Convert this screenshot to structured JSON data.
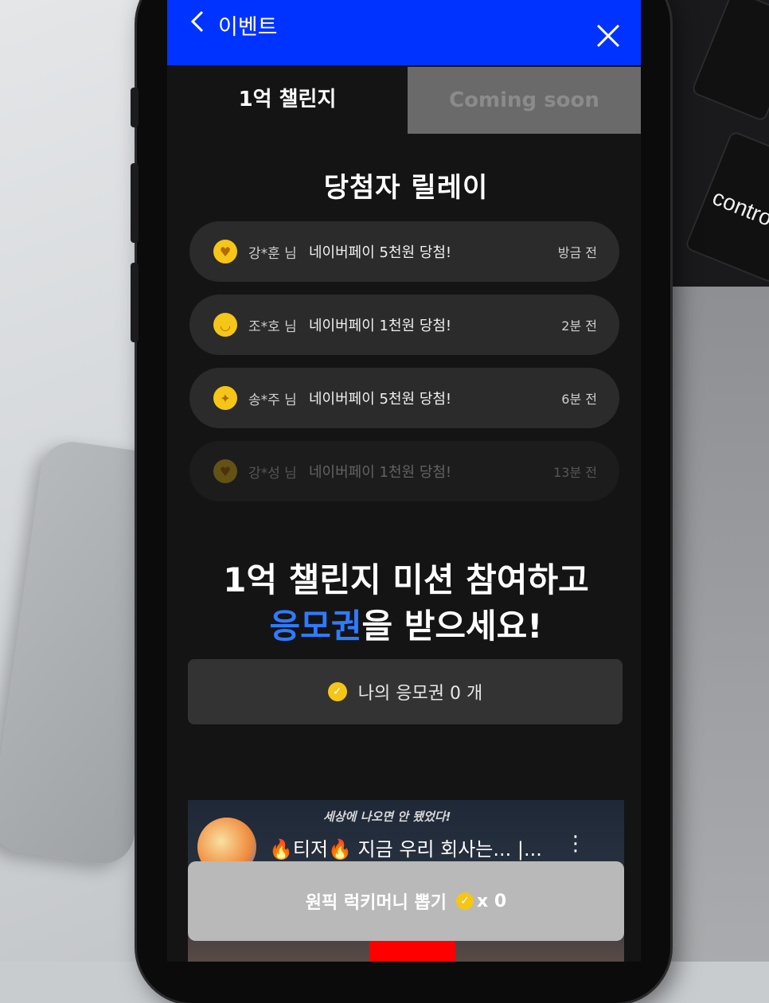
{
  "header": {
    "title": "이벤트"
  },
  "tabs": [
    {
      "label": "1억 챌린지",
      "active": true
    },
    {
      "label": "Coming soon",
      "active": false
    }
  ],
  "relay": {
    "title": "당첨자 릴레이",
    "winners": [
      {
        "emoji": "heart-eyes-emoji",
        "name": "강*훈 님",
        "prize": "네이버페이 5천원 당첨!",
        "time": "방금 전"
      },
      {
        "emoji": "smile-emoji",
        "name": "조*호 님",
        "prize": "네이버페이 1천원 당첨!",
        "time": "2분 전"
      },
      {
        "emoji": "party-emoji",
        "name": "송*주 님",
        "prize": "네이버페이 5천원 당첨!",
        "time": "6분 전"
      },
      {
        "emoji": "kiss-emoji",
        "name": "강*성 님",
        "prize": "네이버페이 1천원 당첨!",
        "time": "13분 전"
      }
    ]
  },
  "mission": {
    "line1": "1억 챌린지 미션 참여하고",
    "highlight": "응모권",
    "line2_rest": "을 받으세요!"
  },
  "tickets": {
    "label": "나의 응모권 0 개"
  },
  "video": {
    "caption": "세상에 나오면 안 됐었다!",
    "title": "🔥티저🔥 지금 우리 회사는... |..."
  },
  "lucky": {
    "label": "원픽 럭키머니 뽑기",
    "count": "x 0"
  },
  "colors": {
    "header": "#0033ff",
    "highlight": "#2f7bff",
    "coin": "#f5c518"
  }
}
